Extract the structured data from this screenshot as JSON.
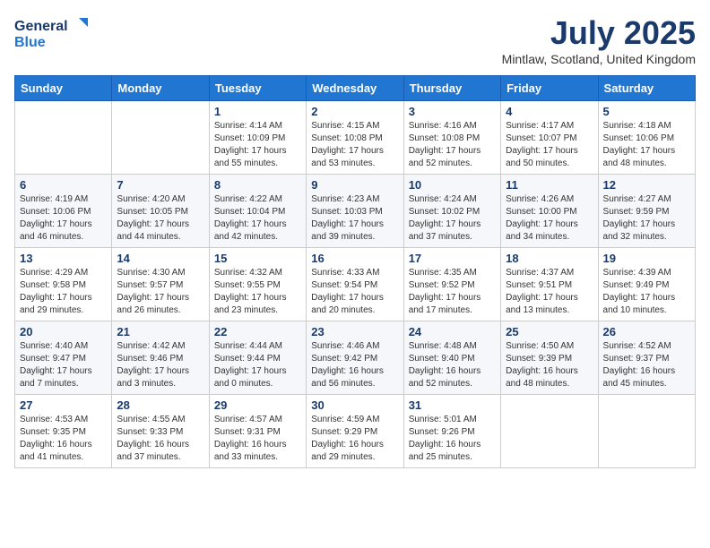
{
  "header": {
    "logo_line1": "General",
    "logo_line2": "Blue",
    "month_title": "July 2025",
    "subtitle": "Mintlaw, Scotland, United Kingdom"
  },
  "days_of_week": [
    "Sunday",
    "Monday",
    "Tuesday",
    "Wednesday",
    "Thursday",
    "Friday",
    "Saturday"
  ],
  "weeks": [
    [
      {
        "day": "",
        "info": ""
      },
      {
        "day": "",
        "info": ""
      },
      {
        "day": "1",
        "info": "Sunrise: 4:14 AM\nSunset: 10:09 PM\nDaylight: 17 hours and 55 minutes."
      },
      {
        "day": "2",
        "info": "Sunrise: 4:15 AM\nSunset: 10:08 PM\nDaylight: 17 hours and 53 minutes."
      },
      {
        "day": "3",
        "info": "Sunrise: 4:16 AM\nSunset: 10:08 PM\nDaylight: 17 hours and 52 minutes."
      },
      {
        "day": "4",
        "info": "Sunrise: 4:17 AM\nSunset: 10:07 PM\nDaylight: 17 hours and 50 minutes."
      },
      {
        "day": "5",
        "info": "Sunrise: 4:18 AM\nSunset: 10:06 PM\nDaylight: 17 hours and 48 minutes."
      }
    ],
    [
      {
        "day": "6",
        "info": "Sunrise: 4:19 AM\nSunset: 10:06 PM\nDaylight: 17 hours and 46 minutes."
      },
      {
        "day": "7",
        "info": "Sunrise: 4:20 AM\nSunset: 10:05 PM\nDaylight: 17 hours and 44 minutes."
      },
      {
        "day": "8",
        "info": "Sunrise: 4:22 AM\nSunset: 10:04 PM\nDaylight: 17 hours and 42 minutes."
      },
      {
        "day": "9",
        "info": "Sunrise: 4:23 AM\nSunset: 10:03 PM\nDaylight: 17 hours and 39 minutes."
      },
      {
        "day": "10",
        "info": "Sunrise: 4:24 AM\nSunset: 10:02 PM\nDaylight: 17 hours and 37 minutes."
      },
      {
        "day": "11",
        "info": "Sunrise: 4:26 AM\nSunset: 10:00 PM\nDaylight: 17 hours and 34 minutes."
      },
      {
        "day": "12",
        "info": "Sunrise: 4:27 AM\nSunset: 9:59 PM\nDaylight: 17 hours and 32 minutes."
      }
    ],
    [
      {
        "day": "13",
        "info": "Sunrise: 4:29 AM\nSunset: 9:58 PM\nDaylight: 17 hours and 29 minutes."
      },
      {
        "day": "14",
        "info": "Sunrise: 4:30 AM\nSunset: 9:57 PM\nDaylight: 17 hours and 26 minutes."
      },
      {
        "day": "15",
        "info": "Sunrise: 4:32 AM\nSunset: 9:55 PM\nDaylight: 17 hours and 23 minutes."
      },
      {
        "day": "16",
        "info": "Sunrise: 4:33 AM\nSunset: 9:54 PM\nDaylight: 17 hours and 20 minutes."
      },
      {
        "day": "17",
        "info": "Sunrise: 4:35 AM\nSunset: 9:52 PM\nDaylight: 17 hours and 17 minutes."
      },
      {
        "day": "18",
        "info": "Sunrise: 4:37 AM\nSunset: 9:51 PM\nDaylight: 17 hours and 13 minutes."
      },
      {
        "day": "19",
        "info": "Sunrise: 4:39 AM\nSunset: 9:49 PM\nDaylight: 17 hours and 10 minutes."
      }
    ],
    [
      {
        "day": "20",
        "info": "Sunrise: 4:40 AM\nSunset: 9:47 PM\nDaylight: 17 hours and 7 minutes."
      },
      {
        "day": "21",
        "info": "Sunrise: 4:42 AM\nSunset: 9:46 PM\nDaylight: 17 hours and 3 minutes."
      },
      {
        "day": "22",
        "info": "Sunrise: 4:44 AM\nSunset: 9:44 PM\nDaylight: 17 hours and 0 minutes."
      },
      {
        "day": "23",
        "info": "Sunrise: 4:46 AM\nSunset: 9:42 PM\nDaylight: 16 hours and 56 minutes."
      },
      {
        "day": "24",
        "info": "Sunrise: 4:48 AM\nSunset: 9:40 PM\nDaylight: 16 hours and 52 minutes."
      },
      {
        "day": "25",
        "info": "Sunrise: 4:50 AM\nSunset: 9:39 PM\nDaylight: 16 hours and 48 minutes."
      },
      {
        "day": "26",
        "info": "Sunrise: 4:52 AM\nSunset: 9:37 PM\nDaylight: 16 hours and 45 minutes."
      }
    ],
    [
      {
        "day": "27",
        "info": "Sunrise: 4:53 AM\nSunset: 9:35 PM\nDaylight: 16 hours and 41 minutes."
      },
      {
        "day": "28",
        "info": "Sunrise: 4:55 AM\nSunset: 9:33 PM\nDaylight: 16 hours and 37 minutes."
      },
      {
        "day": "29",
        "info": "Sunrise: 4:57 AM\nSunset: 9:31 PM\nDaylight: 16 hours and 33 minutes."
      },
      {
        "day": "30",
        "info": "Sunrise: 4:59 AM\nSunset: 9:29 PM\nDaylight: 16 hours and 29 minutes."
      },
      {
        "day": "31",
        "info": "Sunrise: 5:01 AM\nSunset: 9:26 PM\nDaylight: 16 hours and 25 minutes."
      },
      {
        "day": "",
        "info": ""
      },
      {
        "day": "",
        "info": ""
      }
    ]
  ]
}
